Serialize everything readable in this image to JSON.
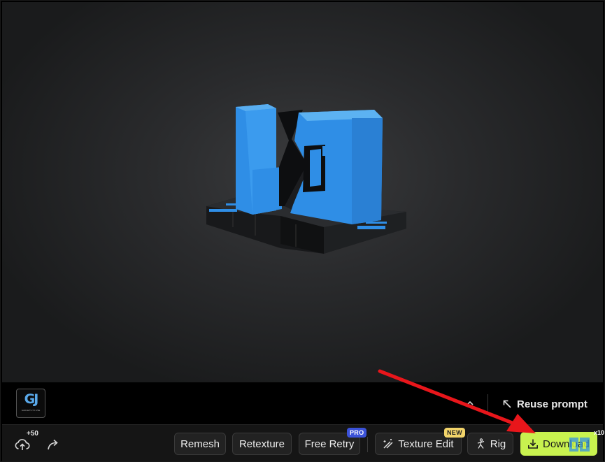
{
  "strip": {
    "thumbnail_label": "GJ",
    "thumbnail_sub": "GADGETS TO USE",
    "reuse_prompt_label": "Reuse prompt"
  },
  "toolbar": {
    "credits_badge": "+50",
    "remesh_label": "Remesh",
    "retexture_label": "Retexture",
    "free_retry_label": "Free Retry",
    "free_retry_tag": "PRO",
    "texture_edit_label": "Texture Edit",
    "texture_edit_tag": "NEW",
    "rig_label": "Rig",
    "download_label": "Download",
    "download_count": "x10"
  },
  "colors": {
    "accent_download": "#c8f24f",
    "tag_pro": "#3b52d9",
    "tag_new": "#f2d46a",
    "model_blue": "#2f8ee6",
    "annotation_arrow": "#e8161b"
  },
  "icons": {
    "upload": "cloud-upload-icon",
    "share": "share-icon",
    "caret": "chevron-up-icon",
    "reuse": "arrow-up-left-icon",
    "texture_edit": "magic-wand-icon",
    "rig": "skeleton-icon",
    "download": "download-icon"
  }
}
